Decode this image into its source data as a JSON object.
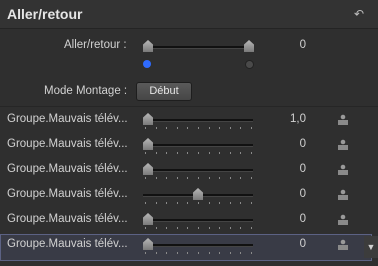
{
  "header": {
    "title": "Aller/retour",
    "reset_icon": "↶"
  },
  "aller_retour": {
    "label": "Aller/retour :",
    "value": "0"
  },
  "mode_montage": {
    "label": "Mode Montage :",
    "button": "Début"
  },
  "rows": [
    {
      "label": "Groupe.Mauvais télév...",
      "value": "1,0",
      "level": 0.0
    },
    {
      "label": "Groupe.Mauvais télév...",
      "value": "0",
      "level": 0.0
    },
    {
      "label": "Groupe.Mauvais télév...",
      "value": "0",
      "level": 0.0
    },
    {
      "label": "Groupe.Mauvais télév...",
      "value": "0",
      "level": 0.5
    },
    {
      "label": "Groupe.Mauvais télév...",
      "value": "0",
      "level": 0.0
    },
    {
      "label": "Groupe.Mauvais télév...",
      "value": "0",
      "level": 0.0
    }
  ],
  "colors": {
    "accent_blue": "#2f6bff",
    "panel": "#2f2f2f",
    "selection": "#393b46"
  }
}
